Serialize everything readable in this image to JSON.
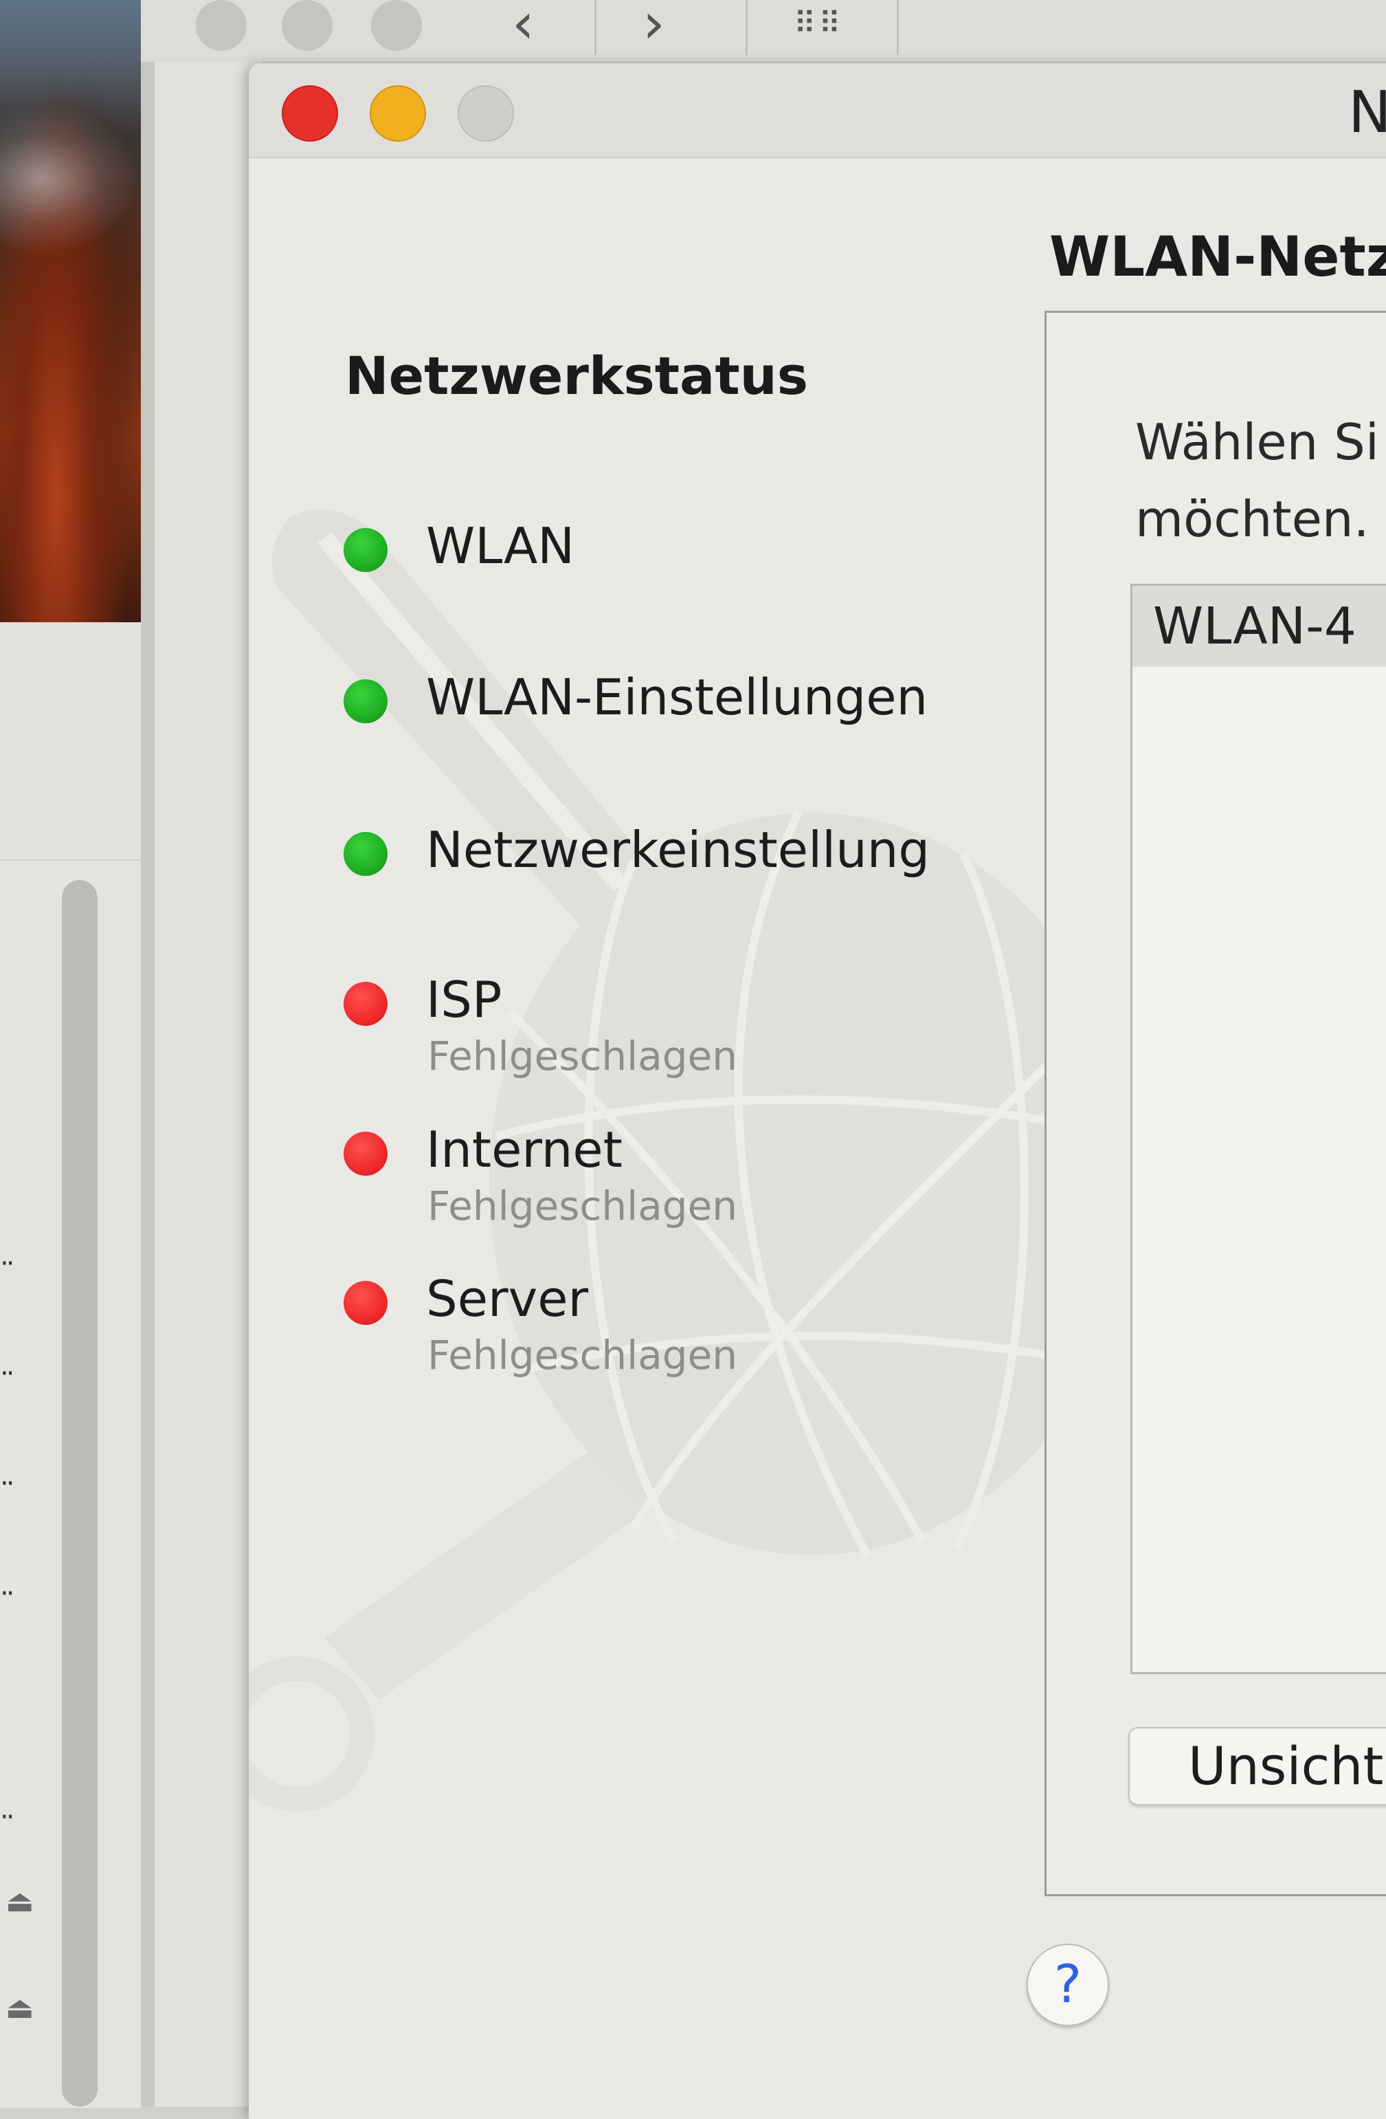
{
  "window": {
    "title": "N"
  },
  "status_panel": {
    "heading": "Netzwerkstatus",
    "items": [
      {
        "label": "WLAN",
        "status": "ok",
        "sub": ""
      },
      {
        "label": "WLAN-Einstellungen",
        "status": "ok",
        "sub": ""
      },
      {
        "label": "Netzwerkeinstellung",
        "status": "ok",
        "sub": ""
      },
      {
        "label": "ISP",
        "status": "failed",
        "sub": "Fehlgeschlagen"
      },
      {
        "label": "Internet",
        "status": "failed",
        "sub": "Fehlgeschlagen"
      },
      {
        "label": "Server",
        "status": "failed",
        "sub": "Fehlgeschlagen"
      }
    ]
  },
  "wlan_pane": {
    "title": "WLAN-Netz",
    "instruction_line1": "Wählen Si",
    "instruction_line2": "möchten.",
    "networks": [
      "WLAN-4"
    ],
    "hidden_button": "Unsicht"
  },
  "help": {
    "label": "?"
  },
  "colors": {
    "ok": "#1fae24",
    "failed": "#ef2a2a",
    "help_accent": "#2d63e0"
  }
}
